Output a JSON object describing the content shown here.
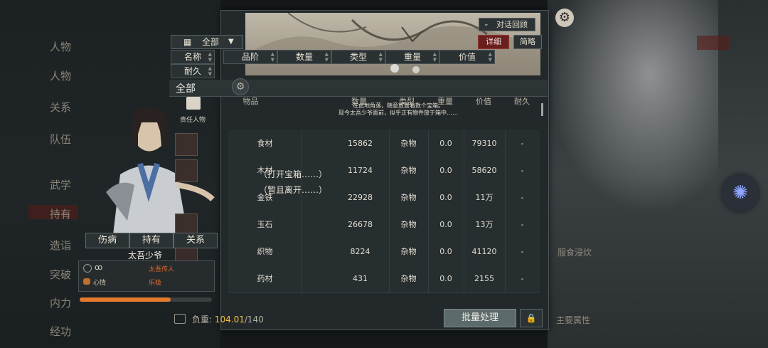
{
  "top_buttons": {
    "dialog_review": "对话回顾",
    "detail": "详细",
    "brief": "简略"
  },
  "filter": {
    "selected": "全部"
  },
  "sort_fields": {
    "row1": [
      "名称",
      "品阶",
      "数量",
      "类型",
      "重量",
      "价值"
    ],
    "row2": [
      "耐久"
    ]
  },
  "section": {
    "title": "全部",
    "character_list_label": "责任人物"
  },
  "columns": [
    "物品",
    "数量",
    "类型",
    "重量",
    "价值",
    "耐久"
  ],
  "notice": {
    "line1": "在此地角落，随意放置着数个宝箱。",
    "line2": "现今太吾少爷面前，似乎正有物件放于箱中……"
  },
  "choices": {
    "open": "（打开宝箱……）",
    "leave": "（暂且离开……）"
  },
  "items": [
    {
      "name": "食材",
      "qty": "15862",
      "type": "杂物",
      "weight": "0.0",
      "value": "79310",
      "durability": "-"
    },
    {
      "name": "木材",
      "qty": "11724",
      "type": "杂物",
      "weight": "0.0",
      "value": "58620",
      "durability": "-"
    },
    {
      "name": "金铁",
      "qty": "22928",
      "type": "杂物",
      "weight": "0.0",
      "value": "11万",
      "durability": "-"
    },
    {
      "name": "玉石",
      "qty": "26678",
      "type": "杂物",
      "weight": "0.0",
      "value": "13万",
      "durability": "-"
    },
    {
      "name": "织物",
      "qty": "8224",
      "type": "杂物",
      "weight": "0.0",
      "value": "41120",
      "durability": "-"
    },
    {
      "name": "药材",
      "qty": "431",
      "type": "杂物",
      "weight": "0.0",
      "value": "2155",
      "durability": "-"
    }
  ],
  "footer": {
    "weight_label": "负重:",
    "weight_current": "104.01",
    "weight_max": "/140",
    "batch_button": "批量处理"
  },
  "character": {
    "tabs": [
      "伤病",
      "持有",
      "关系"
    ],
    "name": "太吾少爷",
    "info_rows": [
      {
        "label": "",
        "value": "太吾传人"
      },
      {
        "label": "心情",
        "value": "乐极"
      }
    ],
    "health_fraction": 0.69
  },
  "background_menu": [
    "人物",
    "人物",
    "关系",
    "队伍",
    "武学",
    "持有",
    "造诣",
    "突破",
    "内力",
    "经功"
  ],
  "background_right": {
    "label1": "服食浸炊",
    "label2": "主要属性"
  },
  "colors": {
    "accent_gold": "#f2c238",
    "detail_red": "#6a1f1f",
    "health_orange": "#e47a2c"
  }
}
